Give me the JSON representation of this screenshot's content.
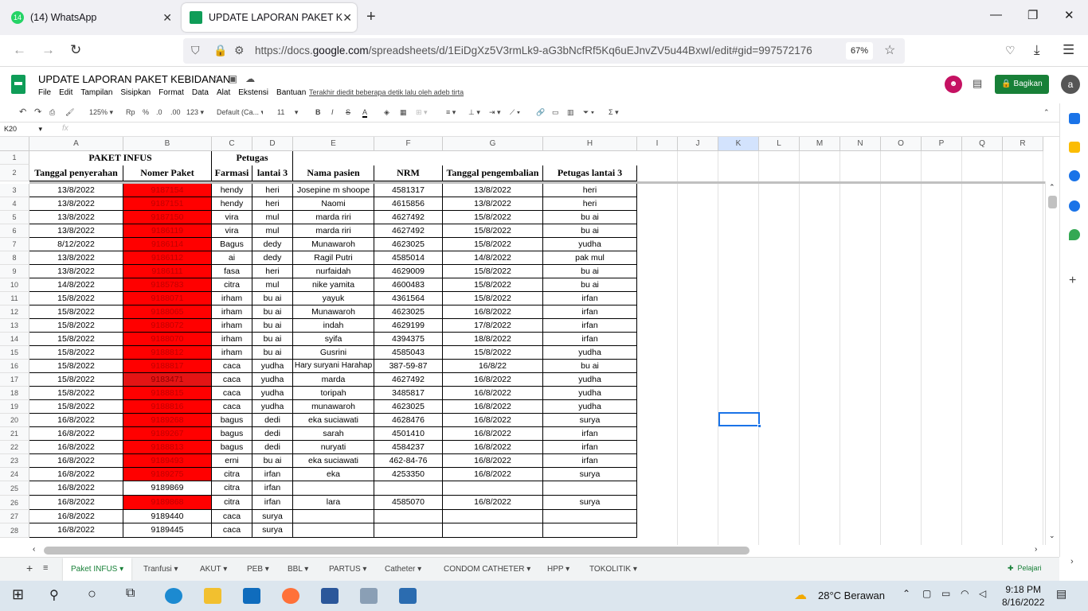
{
  "browser": {
    "tabs": [
      {
        "label": "(14) WhatsApp",
        "badge": "14"
      },
      {
        "label": "UPDATE LAPORAN PAKET KEBIDANAN"
      }
    ],
    "url_prefix": "https://docs.",
    "url_domain": "google.com",
    "url_rest": "/spreadsheets/d/1EiDgXz5V3rmLk9-aG3bNcfRf5Kq6uEJnvZV5u44BxwI/edit#gid=997572176",
    "zoom": "67%"
  },
  "doc": {
    "title": "UPDATE LAPORAN PAKET KEBIDANAN",
    "menu": [
      "File",
      "Edit",
      "Tampilan",
      "Sisipkan",
      "Format",
      "Data",
      "Alat",
      "Ekstensi",
      "Bantuan"
    ],
    "last_edit": "Terakhir diedit beberapa detik lalu oleh adeb tirta",
    "share_label": "Bagikan",
    "account_initial": "a"
  },
  "toolbar": {
    "zoom": "125%",
    "currency": "Rp",
    "percent": "%",
    "dec1": ".0",
    "dec2": ".00",
    "numfmt": "123",
    "font": "Default (Ca...",
    "size": "11",
    "bold": "B",
    "italic": "I",
    "strike": "S",
    "textcolor": "A"
  },
  "formula": {
    "cell_ref": "K20",
    "fx": "fx"
  },
  "columns": [
    "A",
    "B",
    "C",
    "D",
    "E",
    "F",
    "G",
    "H",
    "I",
    "J",
    "K",
    "L",
    "M",
    "N",
    "O",
    "P",
    "Q",
    "R"
  ],
  "header": {
    "title": "PAKET INFUS",
    "petugas": "Petugas",
    "cols": [
      "Tanggal penyerahan",
      "Nomer Paket",
      "Farmasi",
      "lantai 3",
      "Nama pasien",
      "NRM",
      "Tanggal pengembalian",
      "Petugas lantai 3"
    ]
  },
  "rows": [
    {
      "n": "3",
      "a": "13/8/2022",
      "b": "9187154",
      "c": "hendy",
      "d": "heri",
      "e": "Josepine m shoope",
      "f": "4581317",
      "g": "13/8/2022",
      "h": "heri",
      "fill": "red"
    },
    {
      "n": "4",
      "a": "13/8/2022",
      "b": "9187151",
      "c": "hendy",
      "d": "heri",
      "e": "Naomi",
      "f": "4615856",
      "g": "13/8/2022",
      "h": "heri",
      "fill": "red"
    },
    {
      "n": "5",
      "a": "13/8/2022",
      "b": "9187150",
      "c": "vira",
      "d": "mul",
      "e": "marda riri",
      "f": "4627492",
      "g": "15/8/2022",
      "h": "bu ai",
      "fill": "red"
    },
    {
      "n": "6",
      "a": "13/8/2022",
      "b": "9186119",
      "c": "vira",
      "d": "mul",
      "e": "marda riri",
      "f": "4627492",
      "g": "15/8/2022",
      "h": "bu ai",
      "fill": "red"
    },
    {
      "n": "7",
      "a": "8/12/2022",
      "b": "9186114",
      "c": "Bagus",
      "d": "dedy",
      "e": "Munawaroh",
      "f": "4623025",
      "g": "15/8/2022",
      "h": "yudha",
      "fill": "red"
    },
    {
      "n": "8",
      "a": "13/8/2022",
      "b": "9186112",
      "c": "ai",
      "d": "dedy",
      "e": "Ragil Putri",
      "f": "4585014",
      "g": "14/8/2022",
      "h": "pak mul",
      "fill": "red"
    },
    {
      "n": "9",
      "a": "13/8/2022",
      "b": "9186111",
      "c": "fasa",
      "d": "heri",
      "e": "nurfaidah",
      "f": "4629009",
      "g": "15/8/2022",
      "h": "bu ai",
      "fill": "red"
    },
    {
      "n": "10",
      "a": "14/8/2022",
      "b": "9185783",
      "c": "citra",
      "d": "mul",
      "e": "nike yamita",
      "f": "4600483",
      "g": "15/8/2022",
      "h": "bu ai",
      "fill": "red"
    },
    {
      "n": "11",
      "a": "15/8/2022",
      "b": "9188071",
      "c": "irham",
      "d": "bu ai",
      "e": "yayuk",
      "f": "4361564",
      "g": "15/8/2022",
      "h": "irfan",
      "fill": "red"
    },
    {
      "n": "12",
      "a": "15/8/2022",
      "b": "9188065",
      "c": "irham",
      "d": "bu ai",
      "e": "Munawaroh",
      "f": "4623025",
      "g": "16/8/2022",
      "h": "irfan",
      "fill": "red"
    },
    {
      "n": "13",
      "a": "15/8/2022",
      "b": "9188072",
      "c": "irham",
      "d": "bu ai",
      "e": "indah",
      "f": "4629199",
      "g": "17/8/2022",
      "h": "irfan",
      "fill": "red"
    },
    {
      "n": "14",
      "a": "15/8/2022",
      "b": "9188070",
      "c": "irham",
      "d": "bu ai",
      "e": "syifa",
      "f": "4394375",
      "g": "18/8/2022",
      "h": "irfan",
      "fill": "red"
    },
    {
      "n": "15",
      "a": "15/8/2022",
      "b": "9188812",
      "c": "irham",
      "d": "bu ai",
      "e": "Gusrini",
      "f": "4585043",
      "g": "15/8/2022",
      "h": "yudha",
      "fill": "red"
    },
    {
      "n": "16",
      "a": "15/8/2022",
      "b": "9188817",
      "c": "caca",
      "d": "yudha",
      "e": "Hary suryani Harahap",
      "f": "387-59-87",
      "g": "16/8/22",
      "h": "bu ai",
      "fill": "red"
    },
    {
      "n": "17",
      "a": "15/8/2022",
      "b": "9183471",
      "c": "caca",
      "d": "yudha",
      "e": "marda",
      "f": "4627492",
      "g": "16/8/2022",
      "h": "yudha",
      "fill": "darkred"
    },
    {
      "n": "18",
      "a": "15/8/2022",
      "b": "9188815",
      "c": "caca",
      "d": "yudha",
      "e": "toripah",
      "f": "3485817",
      "g": "16/8/2022",
      "h": "yudha",
      "fill": "red"
    },
    {
      "n": "19",
      "a": "15/8/2022",
      "b": "9188816",
      "c": "caca",
      "d": "yudha",
      "e": "munawaroh",
      "f": "4623025",
      "g": "16/8/2022",
      "h": "yudha",
      "fill": "red"
    },
    {
      "n": "20",
      "a": "16/8/2022",
      "b": "9189268",
      "c": "bagus",
      "d": "dedi",
      "e": "eka suciawati",
      "f": "4628476",
      "g": "16/8/2022",
      "h": "surya",
      "fill": "red"
    },
    {
      "n": "21",
      "a": "16/8/2022",
      "b": "9189267",
      "c": "bagus",
      "d": "dedi",
      "e": "sarah",
      "f": "4501410",
      "g": "16/8/2022",
      "h": "irfan",
      "fill": "red"
    },
    {
      "n": "22",
      "a": "16/8/2022",
      "b": "9188813",
      "c": "bagus",
      "d": "dedi",
      "e": "nuryati",
      "f": "4584237",
      "g": "16/8/2022",
      "h": "irfan",
      "fill": "red"
    },
    {
      "n": "23",
      "a": "16/8/2022",
      "b": "9189493",
      "c": "erni",
      "d": "bu ai",
      "e": "eka suciawati",
      "f": "462-84-76",
      "g": "16/8/2022",
      "h": "irfan",
      "fill": "red"
    },
    {
      "n": "24",
      "a": "16/8/2022",
      "b": "9189275",
      "c": "citra",
      "d": "irfan",
      "e": "eka",
      "f": "4253350",
      "g": "16/8/2022",
      "h": "surya",
      "fill": "red"
    },
    {
      "n": "25",
      "a": "16/8/2022",
      "b": "9189869",
      "c": "citra",
      "d": "irfan",
      "e": "",
      "f": "",
      "g": "",
      "h": "",
      "fill": "none"
    },
    {
      "n": "26",
      "a": "16/8/2022",
      "b": "9189868",
      "c": "citra",
      "d": "irfan",
      "e": "lara",
      "f": "4585070",
      "g": "16/8/2022",
      "h": "surya",
      "fill": "red"
    },
    {
      "n": "27",
      "a": "16/8/2022",
      "b": "9189440",
      "c": "caca",
      "d": "surya",
      "e": "",
      "f": "",
      "g": "",
      "h": "",
      "fill": "none"
    },
    {
      "n": "28",
      "a": "16/8/2022",
      "b": "9189445",
      "c": "caca",
      "d": "surya",
      "e": "",
      "f": "",
      "g": "",
      "h": "",
      "fill": "none"
    }
  ],
  "sheets": [
    "Paket INFUS",
    "Tranfusi",
    "AKUT",
    "PEB",
    "BBL",
    "PARTUS",
    "Catheter",
    "CONDOM CATHETER",
    "HPP",
    "TOKOLITIK"
  ],
  "learn_label": "Pelajari",
  "taskbar": {
    "weather": "28°C  Berawan",
    "time": "9:18 PM",
    "date": "8/16/2022"
  },
  "colors": {
    "red_fill": "#ff0000",
    "dark_red_fill": "#e41414",
    "sheets_green": "#188038",
    "selection": "#1a73e8"
  }
}
